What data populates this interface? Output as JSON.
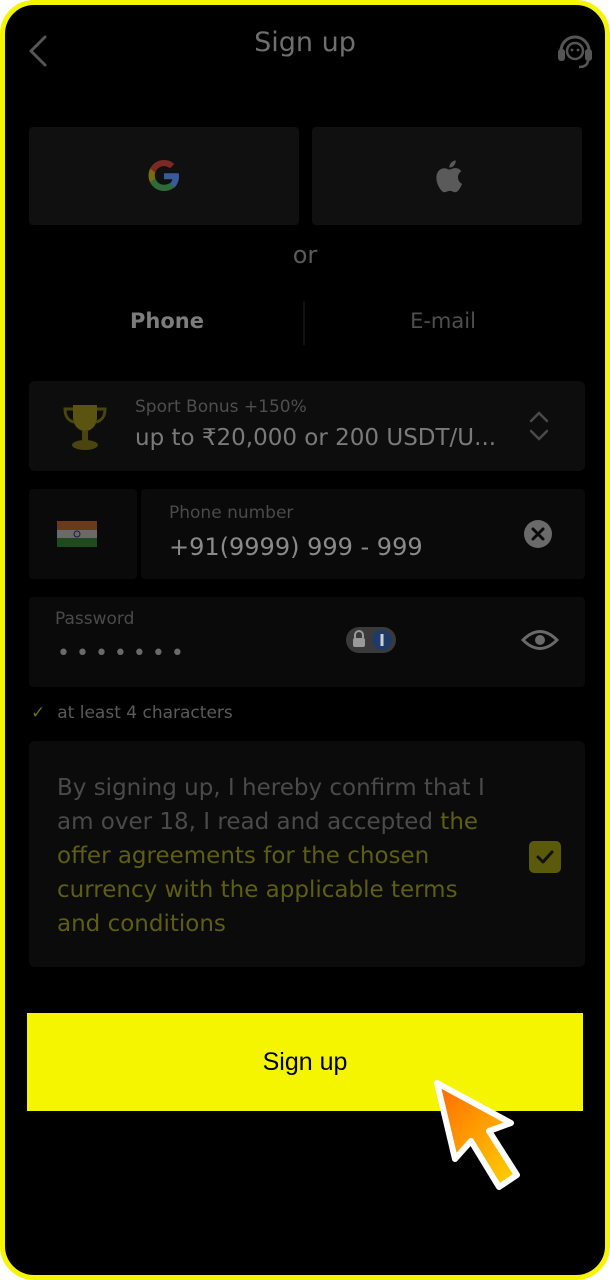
{
  "header": {
    "title": "Sign up",
    "back_icon": "chevron-left-icon",
    "support_icon": "headset-icon"
  },
  "social": {
    "google_icon": "google-icon",
    "apple_icon": "apple-icon",
    "divider_text": "or"
  },
  "tabs": [
    {
      "label": "Phone",
      "active": true
    },
    {
      "label": "E-mail",
      "active": false
    }
  ],
  "bonus": {
    "label": "Sport Bonus +150%",
    "value": "up to ₹20,000 or 200 USDT/U...",
    "icon": "trophy-icon"
  },
  "phone": {
    "country_icon": "india-flag-icon",
    "label": "Phone number",
    "value": "+91(9999) 999 - 999"
  },
  "password": {
    "label": "Password",
    "masked_value": "•••••••"
  },
  "hint": {
    "text": "at least 4 characters"
  },
  "consent": {
    "text_prefix": "By signing up, I hereby confirm that I am over 18, I read and accepted ",
    "link_text": "the offer agreements for the chosen currency with the applicable terms and conditions",
    "checked": true
  },
  "signup_button": {
    "label": "Sign up"
  },
  "colors": {
    "accent": "#f5f500",
    "background": "#000000"
  }
}
